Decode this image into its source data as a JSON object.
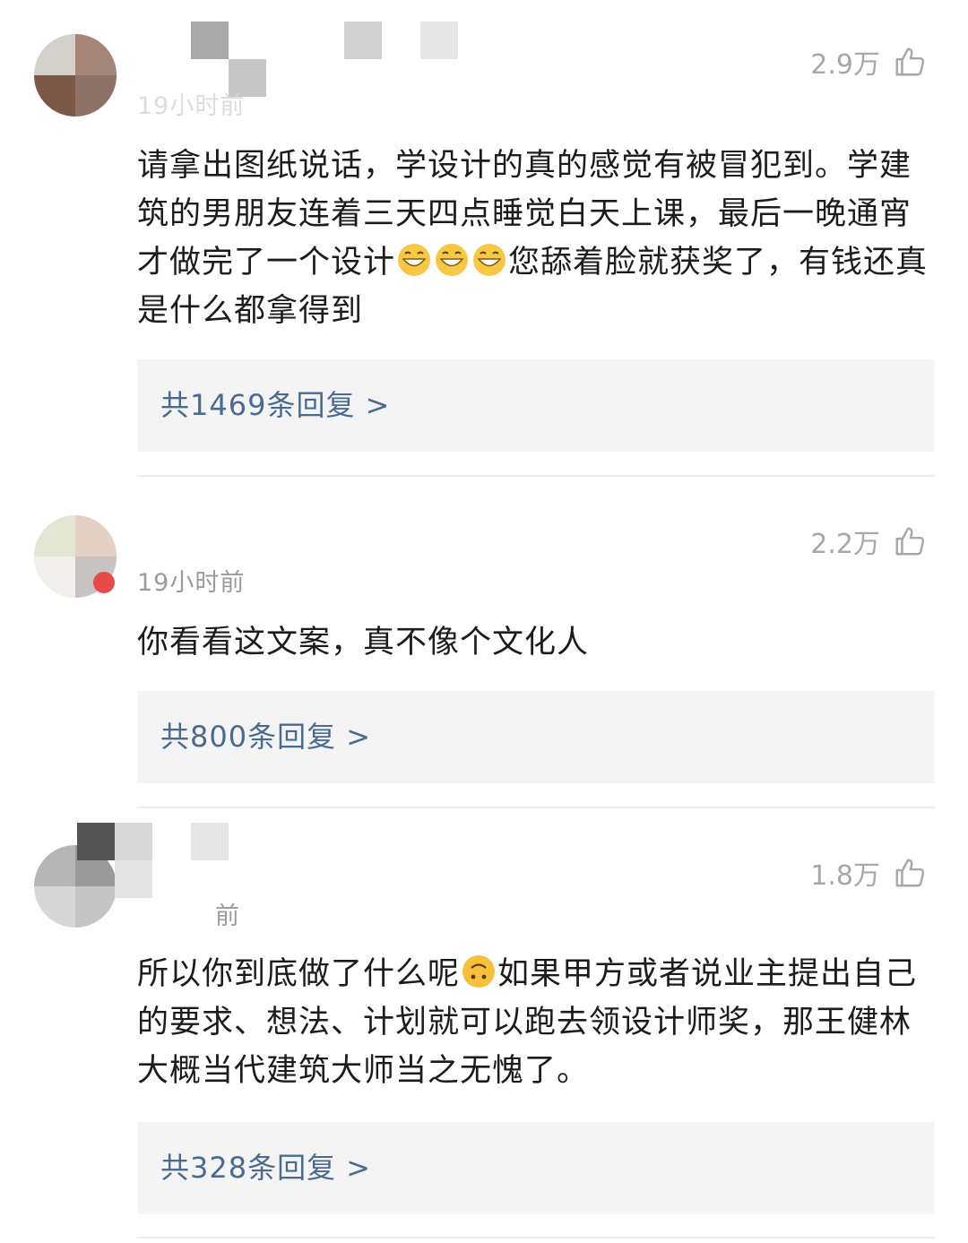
{
  "comments": [
    {
      "likes": "2.9万",
      "time": "19小时前",
      "text_parts": [
        "请拿出图纸说话，学设计的真的感觉有被冒犯到。学建筑的男朋友连着三天四点睡觉白天上课，最后一晚通宵才做完了一个设计",
        "您舔着脸就获奖了，有钱还真是什么都拿得到"
      ],
      "emoji": "grinning-face-emoji",
      "reply_label": "共1469条回复 >"
    },
    {
      "likes": "2.2万",
      "time": "19小时前",
      "text": "你看看这文案，真不像个文化人",
      "reply_label": "共800条回复 >"
    },
    {
      "likes": "1.8万",
      "time": "前",
      "text_parts": [
        "所以你到底做了什么呢",
        "如果甲方或者说业主提出自己的要求、想法、计划就可以跑去领设计师奖，那王健林大概当代建筑大师当之无愧了。"
      ],
      "emoji": "upside-down-face-emoji",
      "reply_label": "共328条回复 >"
    }
  ],
  "colors": {
    "reply_link": "#4a6a92",
    "meta_gray": "#9b9b9b",
    "reply_bg": "#f4f4f4"
  }
}
